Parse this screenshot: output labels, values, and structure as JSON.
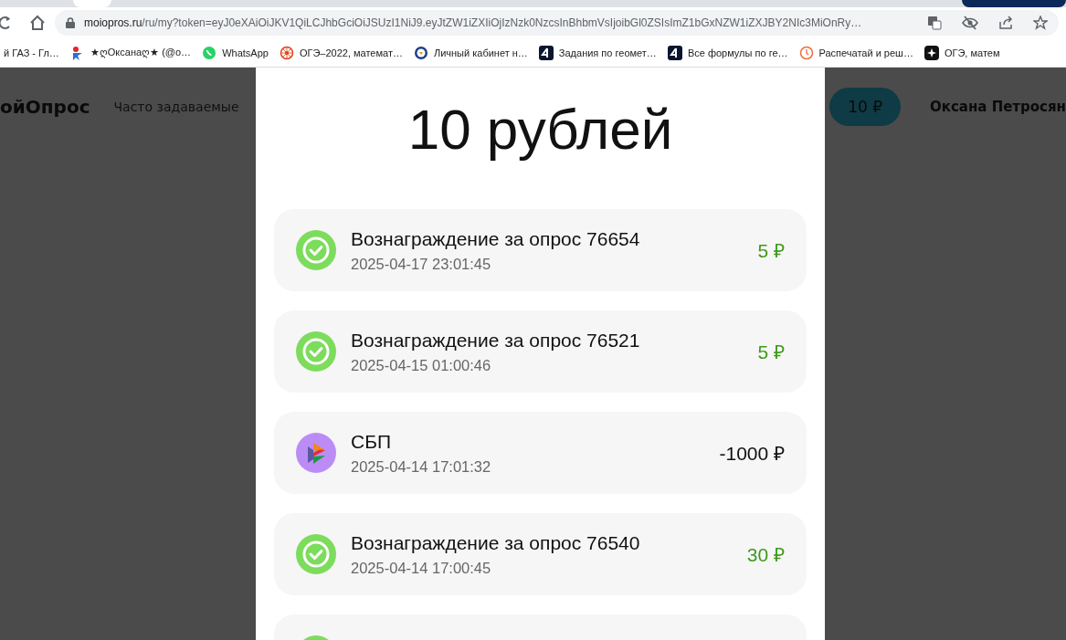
{
  "browser": {
    "address": {
      "domain": "moiopros.ru",
      "path": "/ru/my?token=eyJ0eXAiOiJKV1QiLCJhbGciOiJSUzI1NiJ9.eyJtZW1iZXIiOjIzNzk0NzcsInBhbmVsIjoibGl0ZSIsImZ1bGxNZW1iZXJBY2NIc3MiOnRy…"
    },
    "bookmarks": [
      {
        "kind": "none",
        "label": "й ГАЗ - Гл…"
      },
      {
        "kind": "figure",
        "label": "★ღОксанаღ★ (@о…"
      },
      {
        "kind": "whatsapp",
        "label": "WhatsApp"
      },
      {
        "kind": "wheel",
        "label": "ОГЭ–2022, математ…"
      },
      {
        "kind": "emblem",
        "label": "Личный кабинет н…"
      },
      {
        "kind": "four",
        "label": "Задания по геомет…"
      },
      {
        "kind": "four",
        "label": "Все формулы по ге…"
      },
      {
        "kind": "clock",
        "label": "Распечатай и реш…"
      },
      {
        "kind": "sparkle",
        "label": "ОГЭ, матем"
      }
    ]
  },
  "site_header": {
    "logo": "ойОпрос",
    "nav_link": "Часто задаваемые",
    "balance": "10 ₽",
    "user": "Оксана Петросян"
  },
  "modal": {
    "title": "10 рублей",
    "transactions": [
      {
        "kind": "reward",
        "title": "Вознаграждение за опрос 76654",
        "date": "2025-04-17 23:01:45",
        "amount": "5 ₽"
      },
      {
        "kind": "reward",
        "title": "Вознаграждение за опрос 76521",
        "date": "2025-04-15 01:00:46",
        "amount": "5 ₽"
      },
      {
        "kind": "sbp",
        "title": "СБП",
        "date": "2025-04-14 17:01:32",
        "amount": "-1000 ₽"
      },
      {
        "kind": "reward",
        "title": "Вознаграждение за опрос 76540",
        "date": "2025-04-14 17:00:45",
        "amount": "30 ₽"
      },
      {
        "kind": "reward"
      }
    ]
  }
}
